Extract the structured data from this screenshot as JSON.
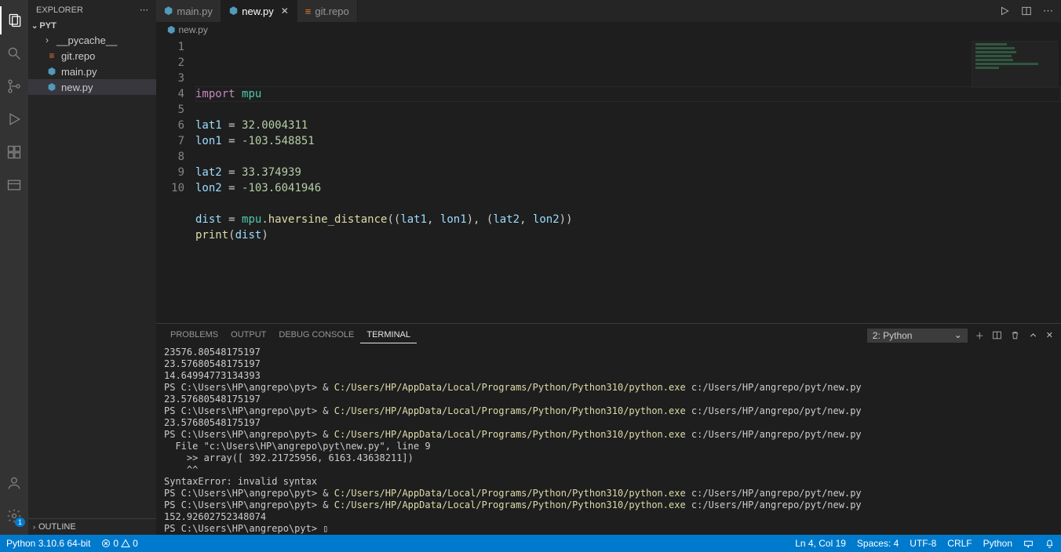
{
  "sidebar": {
    "title": "EXPLORER",
    "root": "PYT",
    "items": [
      {
        "label": "__pycache__",
        "type": "folder"
      },
      {
        "label": "git.repo",
        "type": "repo"
      },
      {
        "label": "main.py",
        "type": "py"
      },
      {
        "label": "new.py",
        "type": "py",
        "active": true
      }
    ],
    "outline": "OUTLINE"
  },
  "tabs": [
    {
      "label": "main.py",
      "type": "py"
    },
    {
      "label": "new.py",
      "type": "py",
      "active": true,
      "close": true
    },
    {
      "label": "git.repo",
      "type": "repo"
    }
  ],
  "breadcrumb": "new.py",
  "code_lines": [
    "import mpu",
    "",
    "lat1 = 32.0004311",
    "lon1 = -103.548851",
    "",
    "lat2 = 33.374939",
    "lon2 = -103.6041946",
    "",
    "dist = mpu.haversine_distance((lat1, lon1), (lat2, lon2))",
    "print(dist)"
  ],
  "panel": {
    "tabs": [
      "PROBLEMS",
      "OUTPUT",
      "DEBUG CONSOLE",
      "TERMINAL"
    ],
    "active_tab": "TERMINAL",
    "selector": "2: Python",
    "terminal": [
      {
        "type": "plain",
        "text": "23576.80548175197"
      },
      {
        "type": "plain",
        "text": "23.57680548175197"
      },
      {
        "type": "plain",
        "text": "14.64994773134393"
      },
      {
        "type": "cmd",
        "prompt": "PS C:\\Users\\HP\\angrepo\\pyt> & ",
        "exe": "C:/Users/HP/AppData/Local/Programs/Python/Python310/python.exe",
        "arg": " c:/Users/HP/angrepo/pyt/new.py"
      },
      {
        "type": "plain",
        "text": "23.57680548175197"
      },
      {
        "type": "cmd",
        "prompt": "PS C:\\Users\\HP\\angrepo\\pyt> & ",
        "exe": "C:/Users/HP/AppData/Local/Programs/Python/Python310/python.exe",
        "arg": " c:/Users/HP/angrepo/pyt/new.py"
      },
      {
        "type": "plain",
        "text": "23.57680548175197"
      },
      {
        "type": "cmd",
        "prompt": "PS C:\\Users\\HP\\angrepo\\pyt> & ",
        "exe": "C:/Users/HP/AppData/Local/Programs/Python/Python310/python.exe",
        "arg": " c:/Users/HP/angrepo/pyt/new.py"
      },
      {
        "type": "plain",
        "text": "  File \"c:\\Users\\HP\\angrepo\\pyt\\new.py\", line 9"
      },
      {
        "type": "plain",
        "text": "    >> array([ 392.21725956, 6163.43638211])"
      },
      {
        "type": "plain",
        "text": "    ^^"
      },
      {
        "type": "plain",
        "text": "SyntaxError: invalid syntax"
      },
      {
        "type": "cmd",
        "prompt": "PS C:\\Users\\HP\\angrepo\\pyt> & ",
        "exe": "C:/Users/HP/AppData/Local/Programs/Python/Python310/python.exe",
        "arg": " c:/Users/HP/angrepo/pyt/new.py"
      },
      {
        "type": "cmd",
        "prompt": "PS C:\\Users\\HP\\angrepo\\pyt> & ",
        "exe": "C:/Users/HP/AppData/Local/Programs/Python/Python310/python.exe",
        "arg": " c:/Users/HP/angrepo/pyt/new.py"
      },
      {
        "type": "plain",
        "text": "152.92602752348074"
      },
      {
        "type": "plain",
        "text": "PS C:\\Users\\HP\\angrepo\\pyt> ▯"
      }
    ]
  },
  "status": {
    "python": "Python 3.10.6 64-bit",
    "errors": "0",
    "warnings": "0",
    "cursor": "Ln 4, Col 19",
    "spaces": "Spaces: 4",
    "encoding": "UTF-8",
    "eol": "CRLF",
    "lang": "Python"
  },
  "settings_badge": "1"
}
